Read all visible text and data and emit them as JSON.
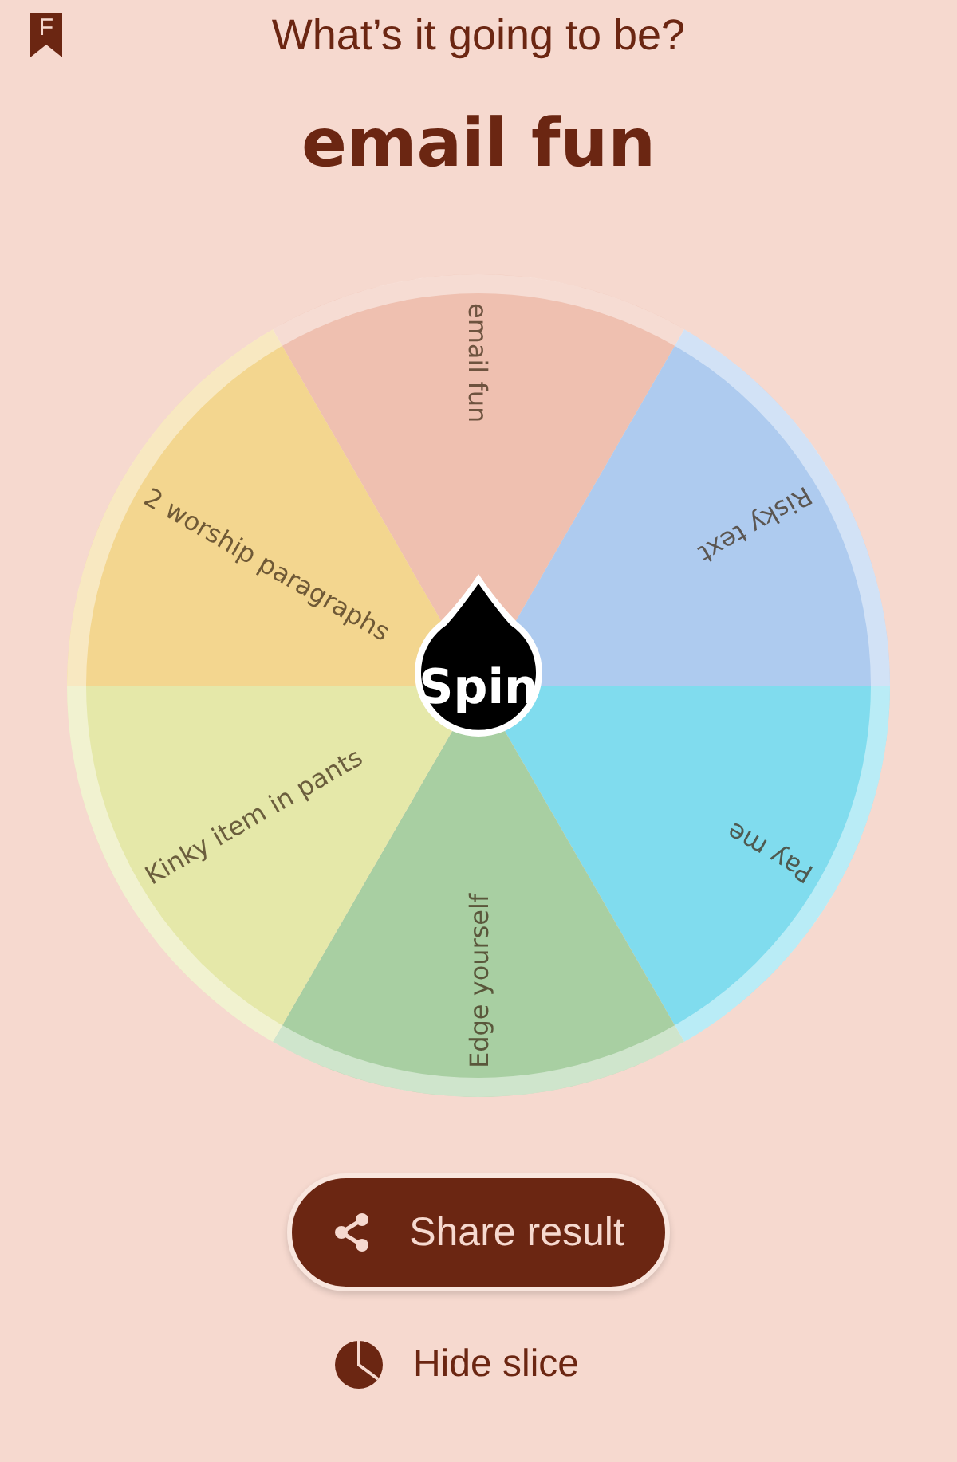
{
  "header": {
    "badge_letter": "F",
    "title": "What’s it going to be?"
  },
  "result": "email fun",
  "wheel": {
    "spin_label": "Spin",
    "slices": [
      {
        "label": "email fun",
        "color": "#efc0b0"
      },
      {
        "label": "Risky text",
        "color": "#aecbef"
      },
      {
        "label": "Pay me",
        "color": "#80dcee"
      },
      {
        "label": "Edge yourself",
        "color": "#a8cfa2"
      },
      {
        "label": "Kinky item in pants",
        "color": "#e5e8a9"
      },
      {
        "label": "2 worship paragraphs",
        "color": "#f3d68f"
      }
    ]
  },
  "share_button": {
    "label": "Share result"
  },
  "hide_slice": {
    "label": "Hide slice"
  }
}
